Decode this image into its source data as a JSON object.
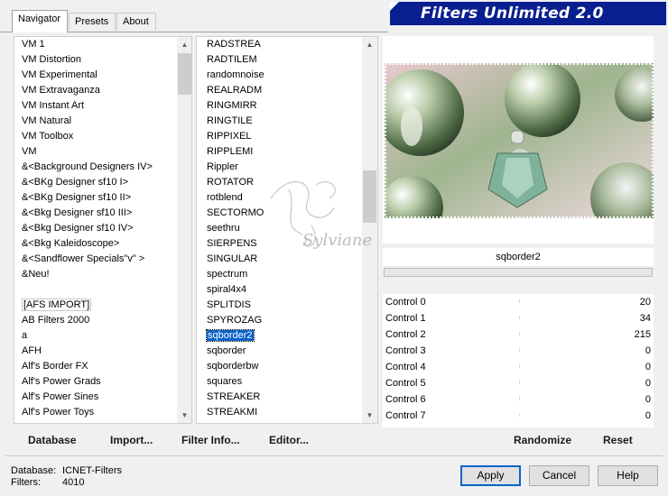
{
  "tabs": [
    {
      "label": "Navigator",
      "active": true
    },
    {
      "label": "Presets",
      "active": false
    },
    {
      "label": "About",
      "active": false
    }
  ],
  "banner": {
    "title": "Filters Unlimited 2.0",
    "color": "#0a1f8f"
  },
  "categories": [
    "VM 1",
    "VM Distortion",
    "VM Experimental",
    "VM Extravaganza",
    "VM Instant Art",
    "VM Natural",
    "VM Toolbox",
    "VM",
    "&<Background Designers IV>",
    "&<BKg Designer sf10 I>",
    "&<BKg Designer sf10 II>",
    "&<Bkg Designer sf10 III>",
    "&<Bkg Designer sf10 IV>",
    "&<Bkg Kaleidoscope>",
    "&<Sandflower Specials\"v\" >",
    "&Neu!",
    "",
    "[AFS IMPORT]",
    "AB Filters 2000",
    "a",
    "AFH",
    "Alf's Border FX",
    "Alf's Power Grads",
    "Alf's Power Sines",
    "Alf's Power Toys"
  ],
  "filters": [
    "RADSTREA",
    "RADTILEM",
    "randomnoise",
    "REALRADM",
    "RINGMIRR",
    "RINGTILE",
    "RIPPIXEL",
    "RIPPLEMI",
    "Rippler",
    "ROTATOR",
    "rotblend",
    "SECTORMO",
    "seethru",
    "SIERPENS",
    "SINGULAR",
    "spectrum",
    "spiral4x4",
    "SPLITDIS",
    "SPYROZAG",
    "sqborder2",
    "sqborder",
    "sqborderbw",
    "squares",
    "STREAKER",
    "STREAKMI"
  ],
  "selected_filter": "sqborder2",
  "boxed_category": "[AFS IMPORT]",
  "filter_name": "sqborder2",
  "controls": [
    {
      "label": "Control 0",
      "value": "20"
    },
    {
      "label": "Control 1",
      "value": "34"
    },
    {
      "label": "Control 2",
      "value": "215"
    },
    {
      "label": "Control 3",
      "value": "0"
    },
    {
      "label": "Control 4",
      "value": "0"
    },
    {
      "label": "Control 5",
      "value": "0"
    },
    {
      "label": "Control 6",
      "value": "0"
    },
    {
      "label": "Control 7",
      "value": "0"
    }
  ],
  "bottom_links": {
    "database": "Database",
    "import": "Import...",
    "filter_info": "Filter Info...",
    "editor": "Editor...",
    "randomize": "Randomize",
    "reset": "Reset"
  },
  "status": {
    "database_label": "Database:",
    "database_value": "ICNET-Filters",
    "filters_label": "Filters:",
    "filters_value": "4010"
  },
  "buttons": {
    "apply": "Apply",
    "cancel": "Cancel",
    "help": "Help"
  },
  "colors": {
    "selection": "#0a63c8",
    "banner": "#0a1f8f"
  }
}
